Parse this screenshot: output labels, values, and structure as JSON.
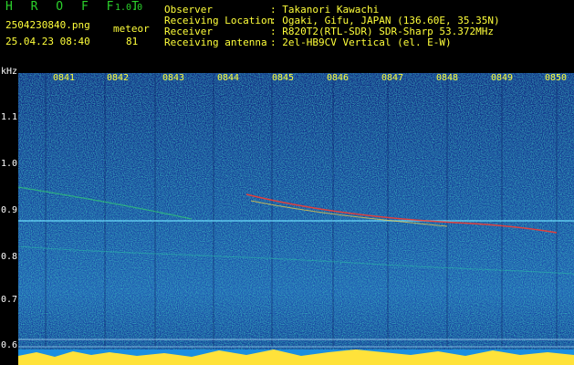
{
  "app": {
    "name": "H R O F F T",
    "version": "1.0.0"
  },
  "file": {
    "name": "2504230840.png",
    "datetime": "25.04.23 08:40"
  },
  "meteor": {
    "label": "meteor",
    "count": "81"
  },
  "station": [
    {
      "key": "Observer",
      "value": ": Takanori Kawachi"
    },
    {
      "key": "Receiving Location",
      "value": ": Ogaki, Gifu, JAPAN (136.60E, 35.35N)"
    },
    {
      "key": "Receiver",
      "value": ": R820T2(RTL-SDR) SDR-Sharp 53.372MHz"
    },
    {
      "key": "Receiving antenna",
      "value": ": 2el-HB9CV Vertical (el. E-W)"
    }
  ],
  "axis": {
    "unit": "kHz",
    "y_ticks": [
      "1.1",
      "1.0",
      "0.9",
      "0.8",
      "0.7",
      "0.6"
    ],
    "x_ticks": [
      "0841",
      "0842",
      "0843",
      "0844",
      "0845",
      "0846",
      "0847",
      "0848",
      "0849",
      "0850"
    ]
  },
  "colors": {
    "background": "#000000",
    "spectrum_low": "#0a1f8c",
    "signal": "#ff2a2a",
    "title": "#2bd12b",
    "label": "#ffff3a"
  }
}
